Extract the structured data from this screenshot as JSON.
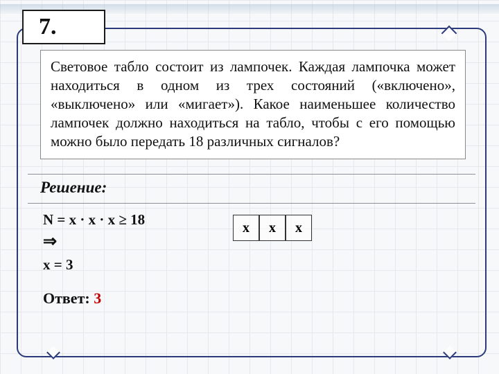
{
  "number": "7.",
  "problem": "Световое табло состоит из лампочек. Каждая лампочка может находиться в одном из трех состояний («включено», «выключено» или «мигает»). Какое наименьшее количество лампочек должно находиться на табло, чтобы с его помощью можно было передать 18 различных сигналов?",
  "solution_label": "Решение:",
  "eq_line": "N = x · x · x ≥ 18",
  "arrow": "⇒",
  "result_line": "x = 3",
  "cells": [
    "x",
    "x",
    "x"
  ],
  "answer_label": "Ответ:",
  "answer_value": "3"
}
